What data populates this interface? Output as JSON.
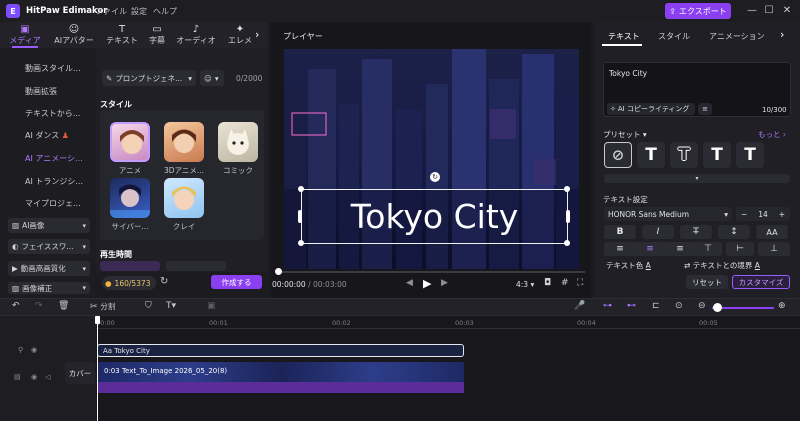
{
  "app": {
    "title": "HitPaw Edimakor",
    "menus": [
      "ファイル",
      "設定",
      "ヘルプ"
    ],
    "export_label": "エクスポート"
  },
  "window_controls": {
    "minimize": "—",
    "maximize": "☐",
    "close": "✕"
  },
  "left_tabs": [
    {
      "label": "メディア",
      "icon": "media-icon"
    },
    {
      "label": "AIアバター",
      "icon": "ai-avatar-icon"
    },
    {
      "label": "テキスト",
      "icon": "text-icon"
    },
    {
      "label": "字幕",
      "icon": "subtitle-icon"
    },
    {
      "label": "オーディオ",
      "icon": "audio-icon"
    },
    {
      "label": "エレメ",
      "icon": "element-icon"
    }
  ],
  "sidebar": {
    "items": [
      "動画スタイル...",
      "動画拡張",
      "テキストから...",
      "AI ダンス",
      "AI アニメーシ...",
      "AI トランジシ...",
      "マイプロジェ..."
    ],
    "groups": [
      "AI画像",
      "フェイススワ...",
      "動画高画質化",
      "画像補正"
    ]
  },
  "content": {
    "prompt_select": "プロンプトジェネ...",
    "char_count": "0/2000",
    "style_heading": "スタイル",
    "styles": [
      "アニメ",
      "3Dアニメ...",
      "コミック",
      "サイバー...",
      "クレイ"
    ],
    "duration_heading": "再生時間",
    "credits": "160/5373",
    "create_label": "作成する"
  },
  "player": {
    "label": "プレイヤー",
    "overlay_text": "Tokyo City",
    "current_time": "00:00:00",
    "total_time": "00:03:00",
    "aspect": "4:3",
    "progress": 0
  },
  "right_panel": {
    "tabs": [
      "テキスト",
      "スタイル",
      "アニメーション"
    ],
    "text_value": "Tokyo City",
    "ai_copy_label": "AI コピーライティング",
    "text_count": "10/300",
    "preset_label": "プリセット",
    "more_label": "もっと",
    "settings_label": "テキスト設定",
    "font_name": "HONOR Sans Medium",
    "font_size": "14",
    "format_buttons": [
      "B",
      "I",
      "T̶",
      "↕",
      "AA"
    ],
    "text_color_label": "テキスト色",
    "border_label": "テキストとの境界",
    "reset_label": "リセット",
    "customize_label": "カスタマイズ"
  },
  "toolbar": {
    "split_label": "分割"
  },
  "timeline": {
    "ticks": [
      "00:00",
      "00:01",
      "00:02",
      "00:03",
      "00:04",
      "00:05"
    ],
    "text_clip": "Aa Tokyo City",
    "video_clip": "0:03  Text_To_Image 2026_05_20(8)",
    "cover_label": "カバー"
  }
}
